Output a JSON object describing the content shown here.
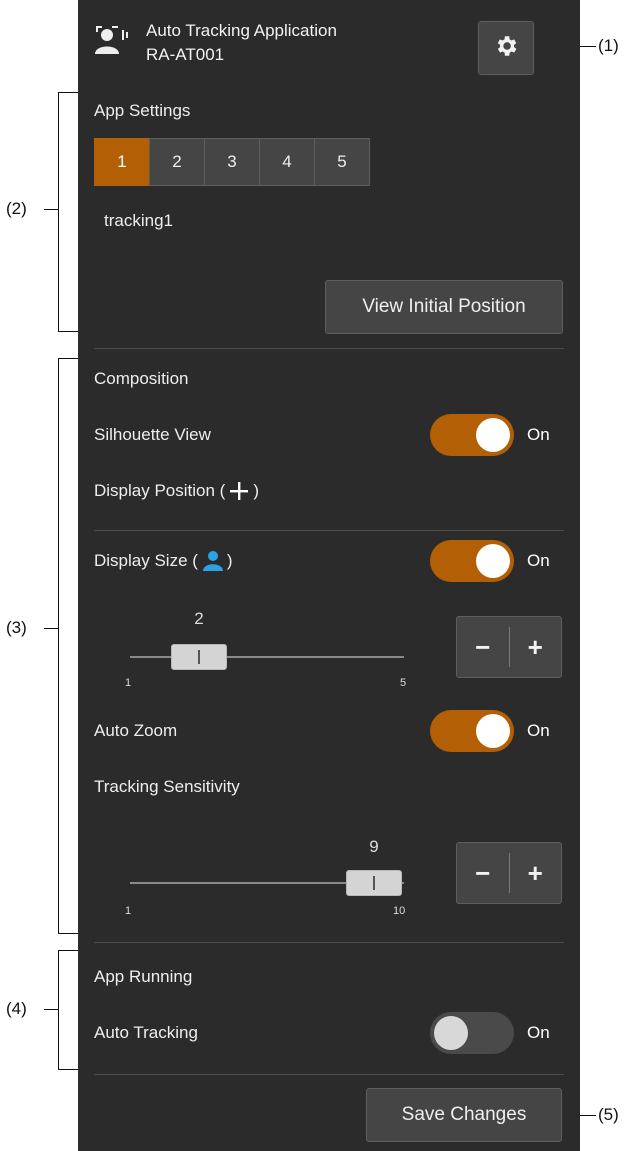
{
  "header": {
    "app_name": "Auto Tracking Application",
    "app_model": "RA-AT001",
    "settings_icon": "gear-icon",
    "app_icon": "person-tracking-icon"
  },
  "app_settings": {
    "title": "App Settings",
    "tabs": [
      "1",
      "2",
      "3",
      "4",
      "5"
    ],
    "active_tab": "1",
    "preset_name": "tracking1",
    "view_initial_position_label": "View Initial Position"
  },
  "composition": {
    "title": "Composition",
    "silhouette_view": {
      "label": "Silhouette View",
      "state": "On"
    },
    "display_position": {
      "label_prefix": "Display Position (",
      "label_suffix": ")",
      "icon": "crosshair-plus-icon"
    },
    "display_size": {
      "label_prefix": "Display Size (",
      "label_suffix": ")",
      "icon": "person-silhouette-icon",
      "state": "On",
      "slider": {
        "value": "2",
        "min": "1",
        "max": "5"
      }
    },
    "auto_zoom": {
      "label": "Auto Zoom",
      "state": "On"
    },
    "tracking_sensitivity": {
      "label": "Tracking Sensitivity",
      "slider": {
        "value": "9",
        "min": "1",
        "max": "10"
      }
    }
  },
  "app_running": {
    "title": "App Running",
    "auto_tracking": {
      "label": "Auto Tracking",
      "state": "On"
    }
  },
  "footer": {
    "save_label": "Save Changes"
  },
  "callouts": [
    "(1)",
    "(2)",
    "(3)",
    "(4)",
    "(5)"
  ],
  "colors": {
    "accent": "#b35f06",
    "panel_bg": "#2b2b2b",
    "icon_blue": "#2aa3e6"
  }
}
